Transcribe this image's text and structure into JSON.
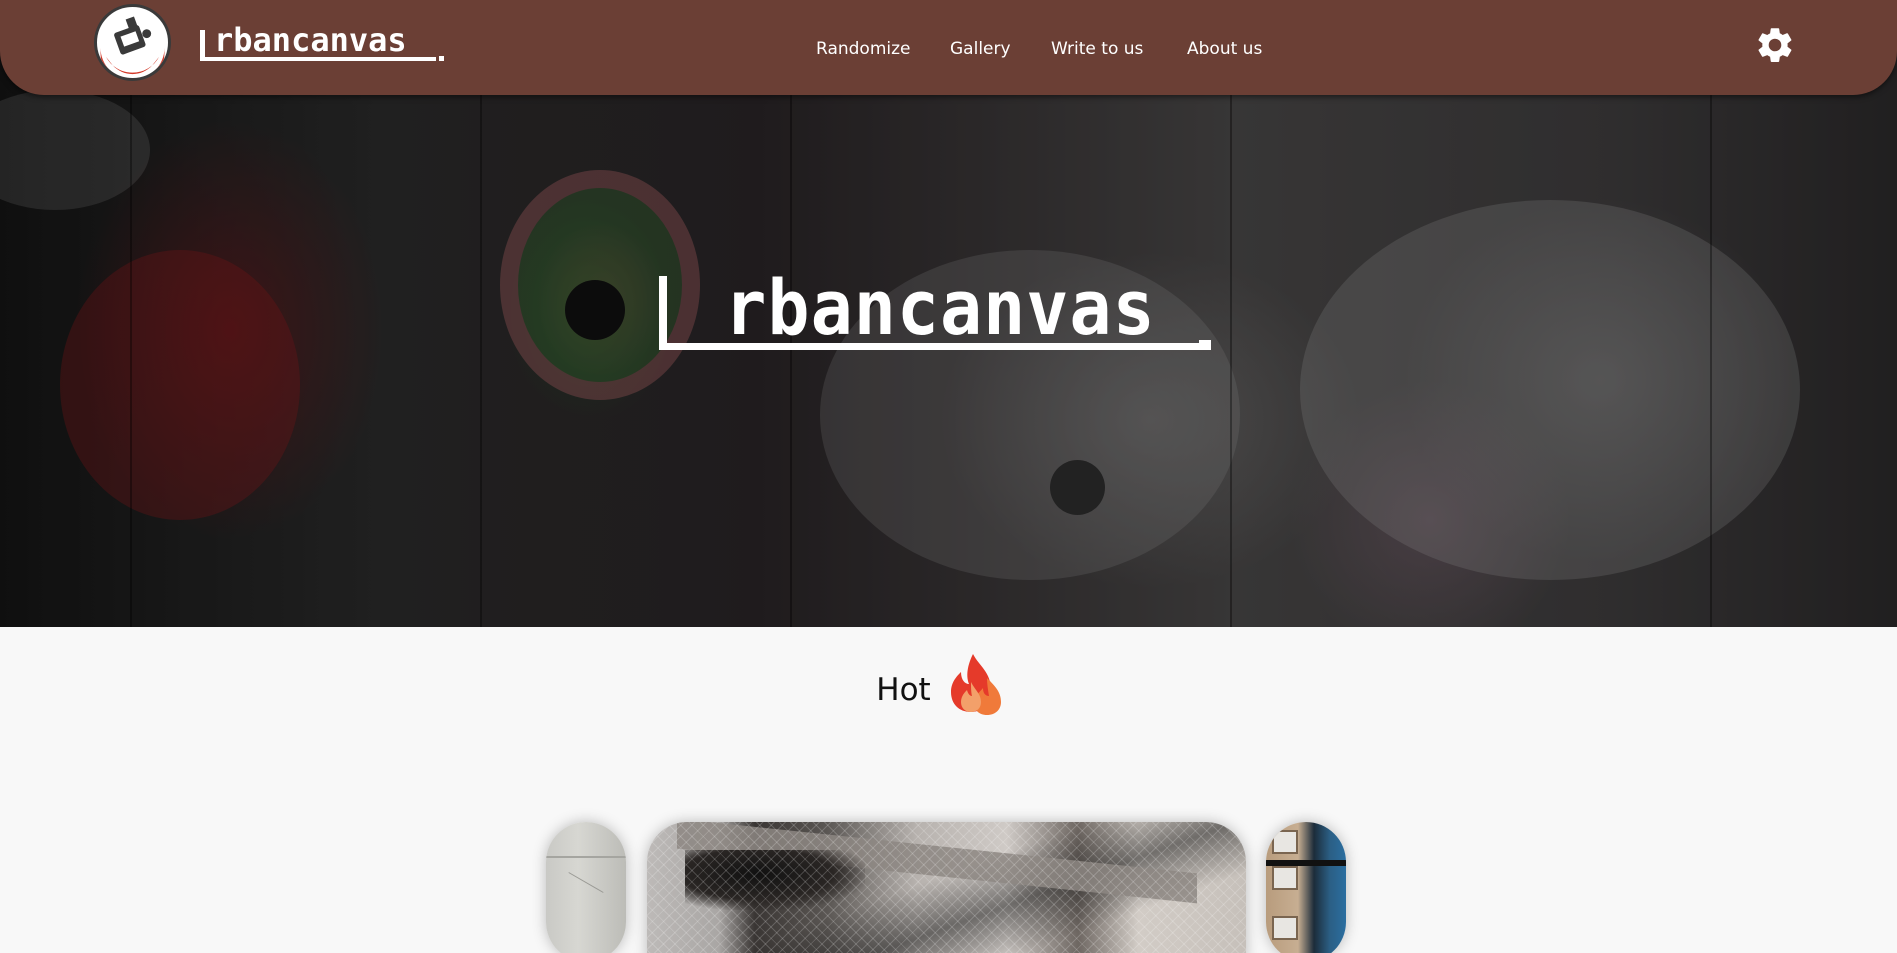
{
  "app": {
    "brand": "Urbancanvas",
    "colors": {
      "navbar": "#6b3f35",
      "text_light": "#ffffff",
      "page_bg": "#f8f8f8"
    }
  },
  "navbar": {
    "logo_icon": "spray-can-logo-icon",
    "brand_label": "rbancanvas",
    "links": [
      {
        "label": "Randomize"
      },
      {
        "label": "Gallery"
      },
      {
        "label": "Write to us"
      },
      {
        "label": "About us"
      }
    ],
    "settings_icon": "gear-icon"
  },
  "hero": {
    "title": "rbancanvas",
    "background": "graffiti-wall"
  },
  "hot": {
    "label": "Hot",
    "icon": "fire-icon"
  },
  "carousel": {
    "cards": [
      {
        "position": "previous",
        "image": "cracked-concrete-wall"
      },
      {
        "position": "current",
        "image": "concrete-bridge-with-net"
      },
      {
        "position": "next",
        "image": "building-facade"
      }
    ]
  }
}
